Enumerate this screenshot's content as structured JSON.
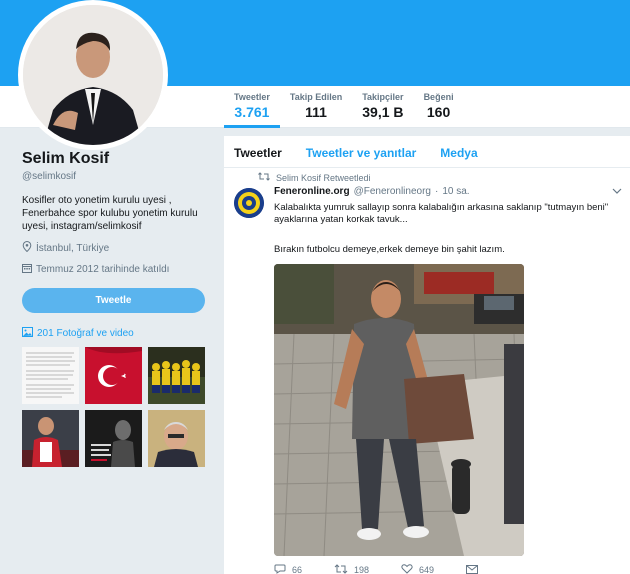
{
  "profile": {
    "name": "Selim Kosif",
    "handle": "@selimkosif",
    "bio": "Kosifler oto yonetim kurulu uyesi , Fenerbahce spor kulubu yonetim kurulu uyesi, instagram/selimkosif",
    "location": "İstanbul, Türkiye",
    "joined": "Temmuz 2012 tarihinde katıldı",
    "tweet_button": "Tweetle",
    "photos_link": "201 Fotoğraf ve video",
    "colors": {
      "accent": "#1da1f2",
      "button": "#5ab4ee",
      "background": "#e6ecf0"
    }
  },
  "stats": [
    {
      "label": "Tweetler",
      "value": "3.761"
    },
    {
      "label": "Takip Edilen",
      "value": "111"
    },
    {
      "label": "Takipçiler",
      "value": "39,1 B"
    },
    {
      "label": "Beğeni",
      "value": "160"
    }
  ],
  "tabs": [
    "Tweetler",
    "Tweetler ve yanıtlar",
    "Medya"
  ],
  "tweet": {
    "retweet_note": "Selim Kosif Retweetledi",
    "author_name": "Feneronline.org",
    "author_handle": "@Feneronlineorg",
    "separator": "·",
    "time": "10 sa.",
    "text1": "Kalabalıkta yumruk sallayıp sonra kalabalığın arkasına saklanıp \"tutmayın beni\" ayaklarına yatan korkak tavuk...",
    "text2": "Bırakın futbolcu demeye,erkek demeye bin şahit lazım.",
    "reply_count": "66",
    "retweet_count": "198",
    "like_count": "649"
  }
}
